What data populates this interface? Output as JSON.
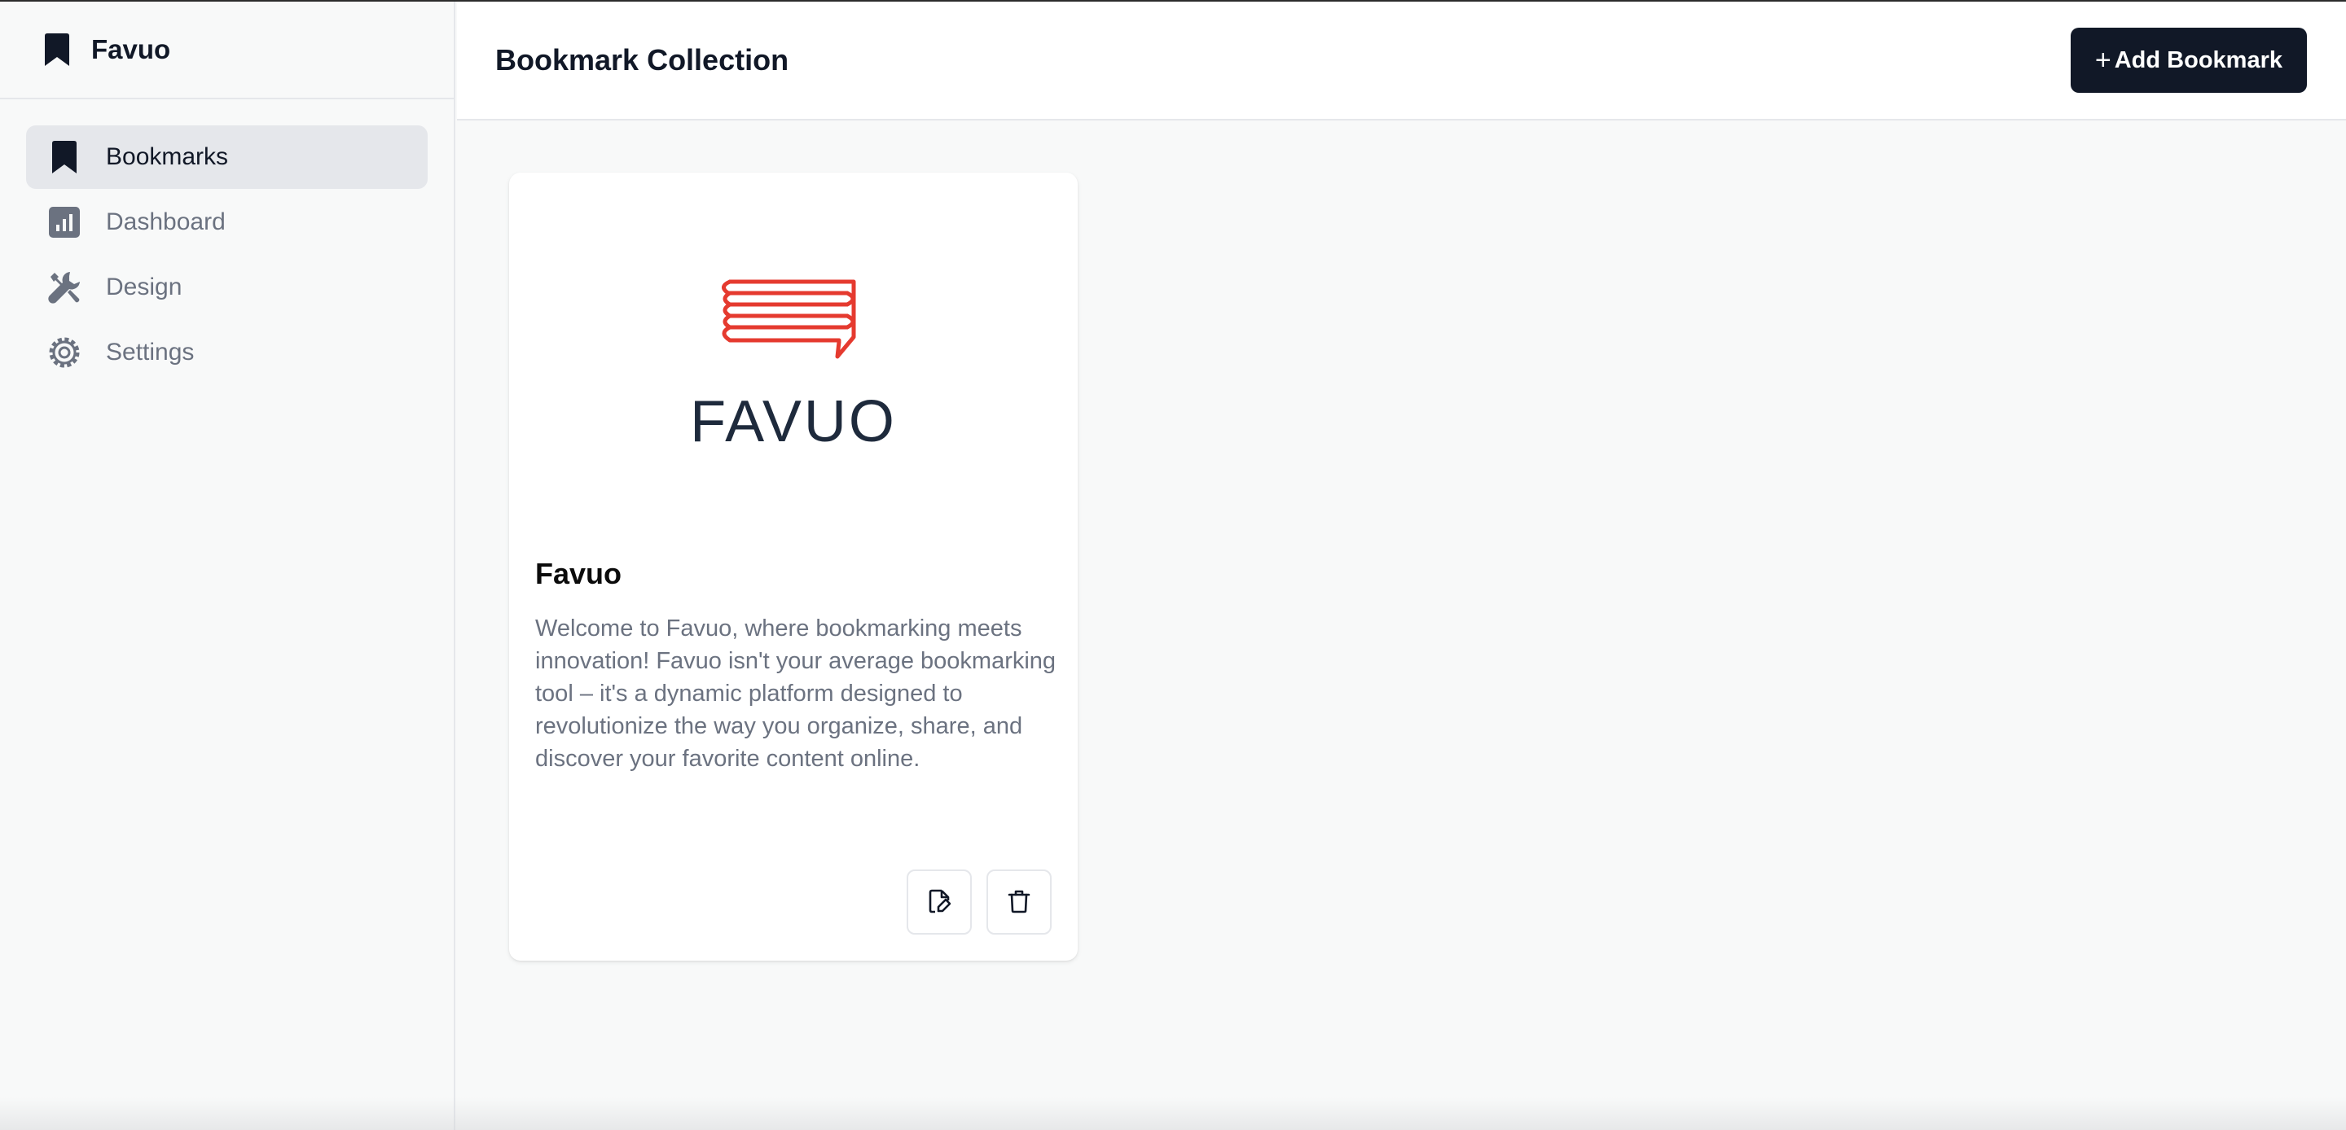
{
  "brand": {
    "name": "Favuo",
    "icon": "bookmark-icon"
  },
  "sidebar": {
    "items": [
      {
        "label": "Bookmarks",
        "icon": "bookmark-icon",
        "active": true
      },
      {
        "label": "Dashboard",
        "icon": "bar-chart-icon",
        "active": false
      },
      {
        "label": "Design",
        "icon": "tools-icon",
        "active": false
      },
      {
        "label": "Settings",
        "icon": "gear-icon",
        "active": false
      }
    ]
  },
  "header": {
    "title": "Bookmark Collection",
    "add_button": {
      "plus": "+",
      "label": "Add Bookmark"
    }
  },
  "bookmarks": [
    {
      "logo_text": "FAVUO",
      "title": "Favuo",
      "description": "Welcome to Favuo, where bookmarking meets innovation! Favuo isn't your average bookmarking tool – it's a dynamic platform designed to revolutionize the way you organize, share, and discover your favorite content online.",
      "actions": [
        {
          "icon": "edit-file-icon"
        },
        {
          "icon": "trash-icon"
        }
      ]
    }
  ],
  "colors": {
    "primary": "#111827",
    "muted_text": "#6b7280",
    "active_bg": "#e5e7eb",
    "logo_red": "#e53a2f",
    "logo_navy": "#1e2a3c"
  }
}
